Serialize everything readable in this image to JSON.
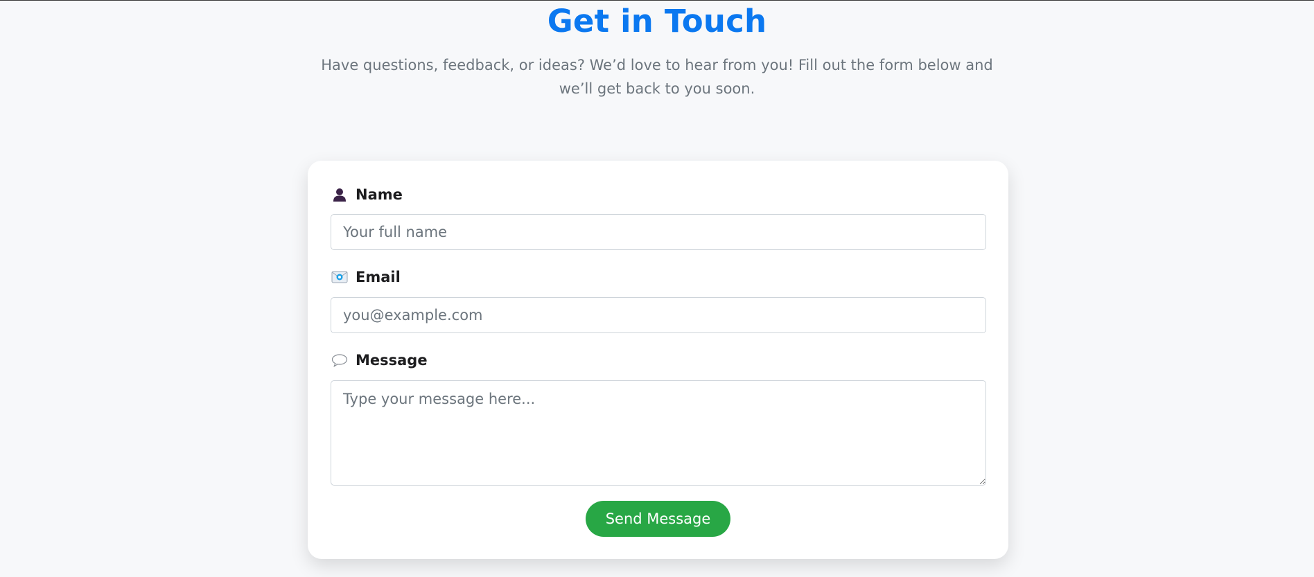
{
  "header": {
    "title": "Get in Touch",
    "intro": "Have questions, feedback, or ideas? We’d love to hear from you! Fill out the form below and we’ll get back to you soon."
  },
  "form": {
    "name": {
      "label": "Name",
      "icon": "person-icon",
      "placeholder": "Your full name",
      "value": ""
    },
    "email": {
      "label": "Email",
      "icon": "envelope-icon",
      "placeholder": "you@example.com",
      "value": ""
    },
    "message": {
      "label": "Message",
      "icon": "speech-bubble-icon",
      "placeholder": "Type your message here...",
      "value": ""
    },
    "submit_label": "Send Message"
  },
  "colors": {
    "title": "#0b78f0",
    "submit": "#28a745",
    "background": "#f7f8fa"
  }
}
